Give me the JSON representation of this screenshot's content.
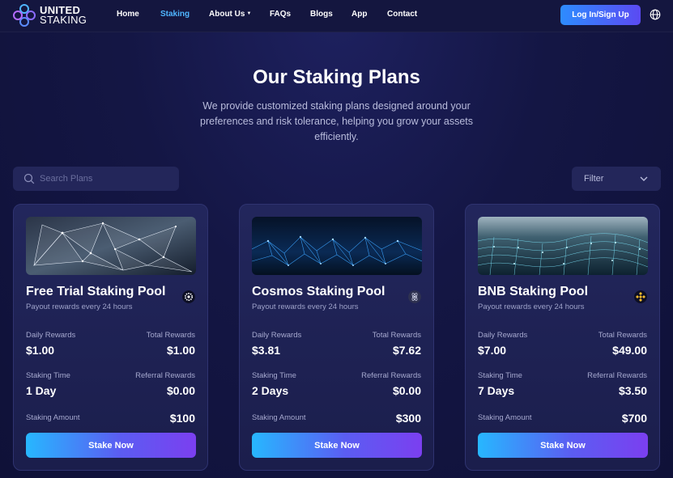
{
  "brand": {
    "line1": "UNITED",
    "line2": "STAKING",
    "accent": "#4fb5ff"
  },
  "nav": {
    "items": [
      {
        "label": "Home"
      },
      {
        "label": "Staking"
      },
      {
        "label": "About Us"
      },
      {
        "label": "FAQs"
      },
      {
        "label": "Blogs"
      },
      {
        "label": "App"
      },
      {
        "label": "Contact"
      }
    ],
    "active": "Staking",
    "login_label": "Log In/Sign Up",
    "language_icon": "globe-icon"
  },
  "hero": {
    "title": "Our Staking Plans",
    "subtitle": "We provide customized staking plans designed around your preferences and risk tolerance, helping you grow your assets efficiently."
  },
  "search": {
    "placeholder": "Search Plans",
    "icon": "search-icon"
  },
  "filter": {
    "label": "Filter",
    "icon": "chevron-down-icon"
  },
  "labels": {
    "daily": "Daily Rewards",
    "total": "Total Rewards",
    "time": "Staking Time",
    "referral": "Referral Rewards",
    "amount": "Staking Amount",
    "stake": "Stake Now"
  },
  "plans": [
    {
      "title": "Free Trial Staking Pool",
      "payout": "Payout rewards every 24 hours",
      "coin_icon": "gear-coin-icon",
      "daily": "$1.00",
      "total": "$1.00",
      "time": "1 Day",
      "referral": "$0.00",
      "amount": "$100"
    },
    {
      "title": "Cosmos Staking Pool",
      "payout": "Payout rewards every 24 hours",
      "coin_icon": "cosmos-coin-icon",
      "daily": "$3.81",
      "total": "$7.62",
      "time": "2 Days",
      "referral": "$0.00",
      "amount": "$300"
    },
    {
      "title": "BNB Staking Pool",
      "payout": "Payout rewards every 24 hours",
      "coin_icon": "bnb-coin-icon",
      "daily": "$7.00",
      "total": "$49.00",
      "time": "7 Days",
      "referral": "$3.50",
      "amount": "$700"
    }
  ]
}
